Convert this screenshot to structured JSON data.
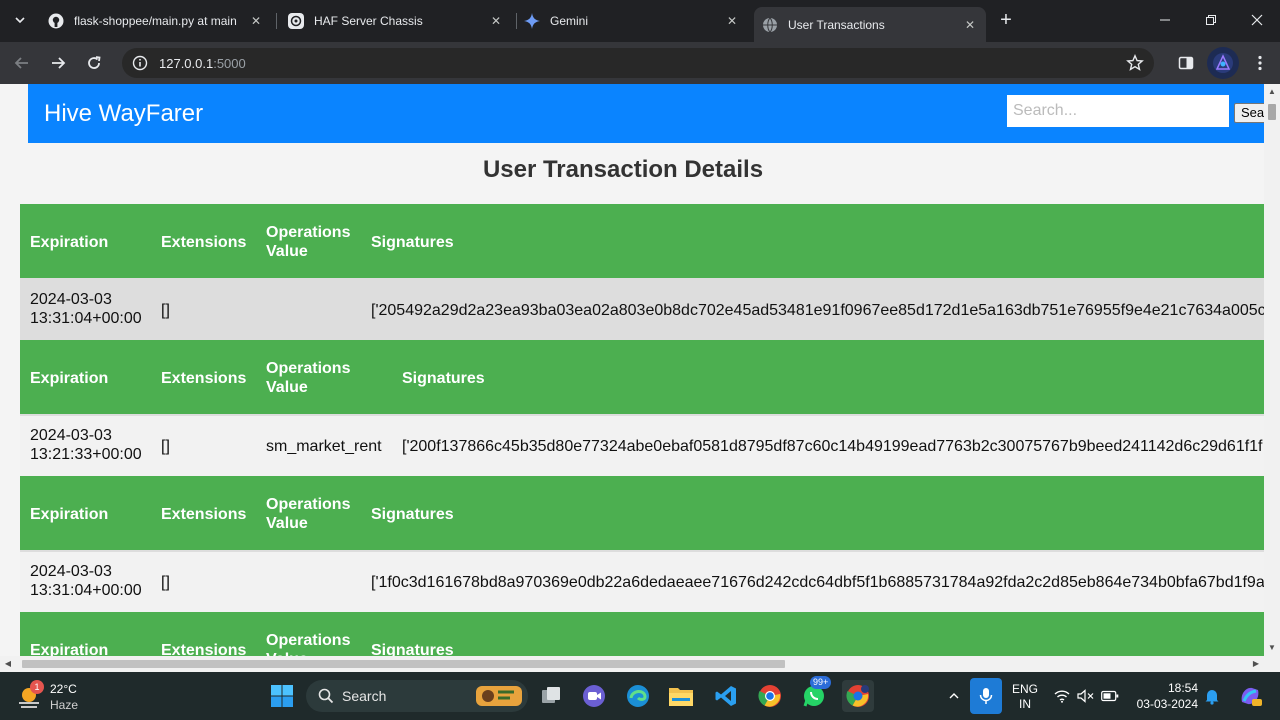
{
  "browser": {
    "tabs": [
      {
        "title": "flask-shoppee/main.py at main",
        "icon": "github-icon"
      },
      {
        "title": "HAF Server Chassis",
        "icon": "chatgpt-icon"
      },
      {
        "title": "Gemini",
        "icon": "gemini-sparkle-icon"
      },
      {
        "title": "User Transactions",
        "icon": "globe-icon"
      }
    ],
    "url_host": "127.0.0.1",
    "url_port": ":5000"
  },
  "page": {
    "brand": "Hive WayFarer",
    "search_placeholder": "Search...",
    "search_button": "Search",
    "title": "User Transaction Details",
    "header_color": "#0a84ff",
    "table_header_color": "#4caf50"
  },
  "table_headers": {
    "expiration": "Expiration",
    "extensions": "Extensions",
    "operations_line1": "Operations",
    "operations_line2": "Value",
    "signatures": "Signatures"
  },
  "transactions": [
    {
      "expiration_date": "2024-03-03",
      "expiration_time": "13:31:04+00:00",
      "extensions": "[]",
      "operations_value": "",
      "signatures": "['205492a29d2a23ea93ba03ea02a803e0b8dc702e45ad53481e91f0967ee85d172d1e5a163db751e76955f9e4e21c7634a005c"
    },
    {
      "expiration_date": "2024-03-03",
      "expiration_time": "13:21:33+00:00",
      "extensions": "[]",
      "operations_value": "sm_market_rent",
      "signatures": "['200f137866c45b35d80e77324abe0ebaf0581d8795df87c60c14b49199ead7763b2c30075767b9beed241142d6c29d61f1f"
    },
    {
      "expiration_date": "2024-03-03",
      "expiration_time": "13:31:04+00:00",
      "extensions": "[]",
      "operations_value": "",
      "signatures": "['1f0c3d161678bd8a970369e0db22a6dedaeaee71676d242cdc64dbf5f1b6885731784a92fda2c2d85eb864e734b0bfa67bd1f9a"
    }
  ],
  "taskbar": {
    "temperature": "22°C",
    "condition": "Haze",
    "weather_badge": "1",
    "search_label": "Search",
    "whatsapp_badge": "99+",
    "lang_line1": "ENG",
    "lang_line2": "IN",
    "time": "18:54",
    "date": "03-03-2024"
  }
}
